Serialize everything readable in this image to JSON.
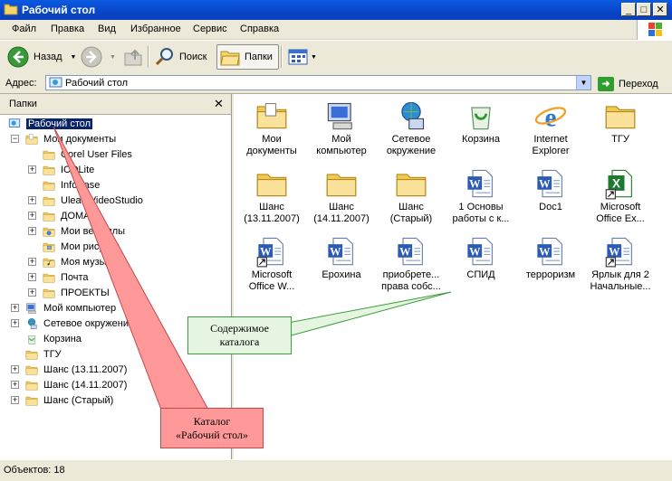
{
  "window": {
    "title": "Рабочий стол"
  },
  "menu": [
    "Файл",
    "Правка",
    "Вид",
    "Избранное",
    "Сервис",
    "Справка"
  ],
  "toolbar": {
    "back_label": "Назад",
    "search_label": "Поиск",
    "folders_label": "Папки"
  },
  "address": {
    "label": "Адрес:",
    "value": "Рабочий стол",
    "go_label": "Переход"
  },
  "folders_pane": {
    "title": "Папки",
    "close": "✕",
    "tree": [
      {
        "label": "Рабочий стол",
        "selected": true
      },
      {
        "label": "Мои документы"
      },
      {
        "label": "Corel User Files"
      },
      {
        "label": "ICQLite"
      },
      {
        "label": "InfoBase"
      },
      {
        "label": "Ulead VideoStudio"
      },
      {
        "label": "ДОМА"
      },
      {
        "label": "Мои веб-узлы"
      },
      {
        "label": "Мои рисунки"
      },
      {
        "label": "Моя музыка"
      },
      {
        "label": "Почта"
      },
      {
        "label": "ПРОЕКТЫ"
      },
      {
        "label": "Мой компьютер"
      },
      {
        "label": "Сетевое окружение"
      },
      {
        "label": "Корзина"
      },
      {
        "label": "ТГУ"
      },
      {
        "label": "Шанс (13.11.2007)"
      },
      {
        "label": "Шанс (14.11.2007)"
      },
      {
        "label": "Шанс (Старый)"
      }
    ]
  },
  "items": [
    {
      "line1": "Мои",
      "line2": "документы",
      "icon": "my-documents-icon"
    },
    {
      "line1": "Мой",
      "line2": "компьютер",
      "icon": "my-computer-icon"
    },
    {
      "line1": "Сетевое",
      "line2": "окружение",
      "icon": "network-icon"
    },
    {
      "line1": "Корзина",
      "line2": "",
      "icon": "recycle-bin-icon"
    },
    {
      "line1": "Internet",
      "line2": "Explorer",
      "icon": "ie-icon"
    },
    {
      "line1": "ТГУ",
      "line2": "",
      "icon": "folder-icon"
    },
    {
      "line1": "Шанс",
      "line2": "(13.11.2007)",
      "icon": "folder-icon"
    },
    {
      "line1": "Шанс",
      "line2": "(14.11.2007)",
      "icon": "folder-icon"
    },
    {
      "line1": "Шанс",
      "line2": "(Старый)",
      "icon": "folder-icon"
    },
    {
      "line1": "1 Основы",
      "line2": "работы с к...",
      "icon": "word-doc-icon"
    },
    {
      "line1": "Doc1",
      "line2": "",
      "icon": "word-doc-icon"
    },
    {
      "line1": "Microsoft",
      "line2": "Office Ex...",
      "icon": "excel-shortcut-icon"
    },
    {
      "line1": "Microsoft",
      "line2": "Office W...",
      "icon": "word-shortcut-icon"
    },
    {
      "line1": "Ерохина",
      "line2": "",
      "icon": "word-doc-icon"
    },
    {
      "line1": "приобрете...",
      "line2": "права собс...",
      "icon": "word-doc-icon"
    },
    {
      "line1": "СПИД",
      "line2": "",
      "icon": "word-doc-icon"
    },
    {
      "line1": "терроризм",
      "line2": "",
      "icon": "word-doc-icon"
    },
    {
      "line1": "Ярлык для 2",
      "line2": "Начальные...",
      "icon": "word-shortcut-icon"
    }
  ],
  "status": {
    "text": "Объектов: 18"
  },
  "annotations": {
    "content_line1": "Содержимое",
    "content_line2": "каталога",
    "catalog_line1": "Каталог",
    "catalog_line2": "«Рабочий стол»"
  },
  "colors": {
    "titlebar": "#0a5ae0",
    "selection": "#0a246a",
    "callout_green": "#e6f5e1",
    "callout_red": "#ff9999"
  }
}
